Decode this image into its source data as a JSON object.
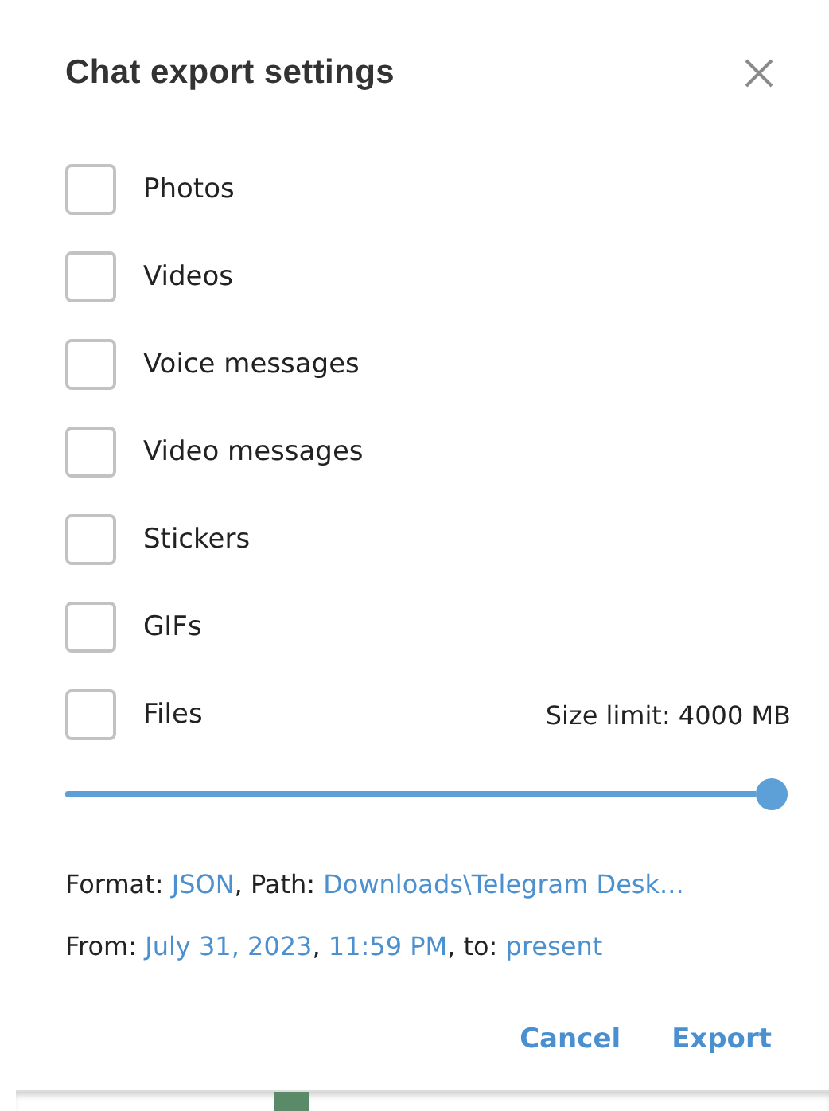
{
  "dialog": {
    "title": "Chat export settings"
  },
  "options": [
    {
      "label": "Photos",
      "checked": false
    },
    {
      "label": "Videos",
      "checked": false
    },
    {
      "label": "Voice messages",
      "checked": false
    },
    {
      "label": "Video messages",
      "checked": false
    },
    {
      "label": "Stickers",
      "checked": false
    },
    {
      "label": "GIFs",
      "checked": false
    },
    {
      "label": "Files",
      "checked": false,
      "size_limit": "Size limit: 4000 MB"
    }
  ],
  "size_slider": {
    "level": 1
  },
  "info_lines": [
    [
      {
        "kind": "text",
        "text": "Format: "
      },
      {
        "kind": "link",
        "text": "JSON"
      },
      {
        "kind": "text",
        "text": ", Path: "
      },
      {
        "kind": "link",
        "text": "Downloads\\Telegram Desk..."
      }
    ],
    [
      {
        "kind": "text",
        "text": "From: "
      },
      {
        "kind": "link",
        "text": "July 31, 2023"
      },
      {
        "kind": "text",
        "text": ", "
      },
      {
        "kind": "link",
        "text": "11:59 PM"
      },
      {
        "kind": "text",
        "text": ", to: "
      },
      {
        "kind": "link",
        "text": "present"
      }
    ]
  ],
  "buttons": [
    "Cancel",
    "Export"
  ]
}
